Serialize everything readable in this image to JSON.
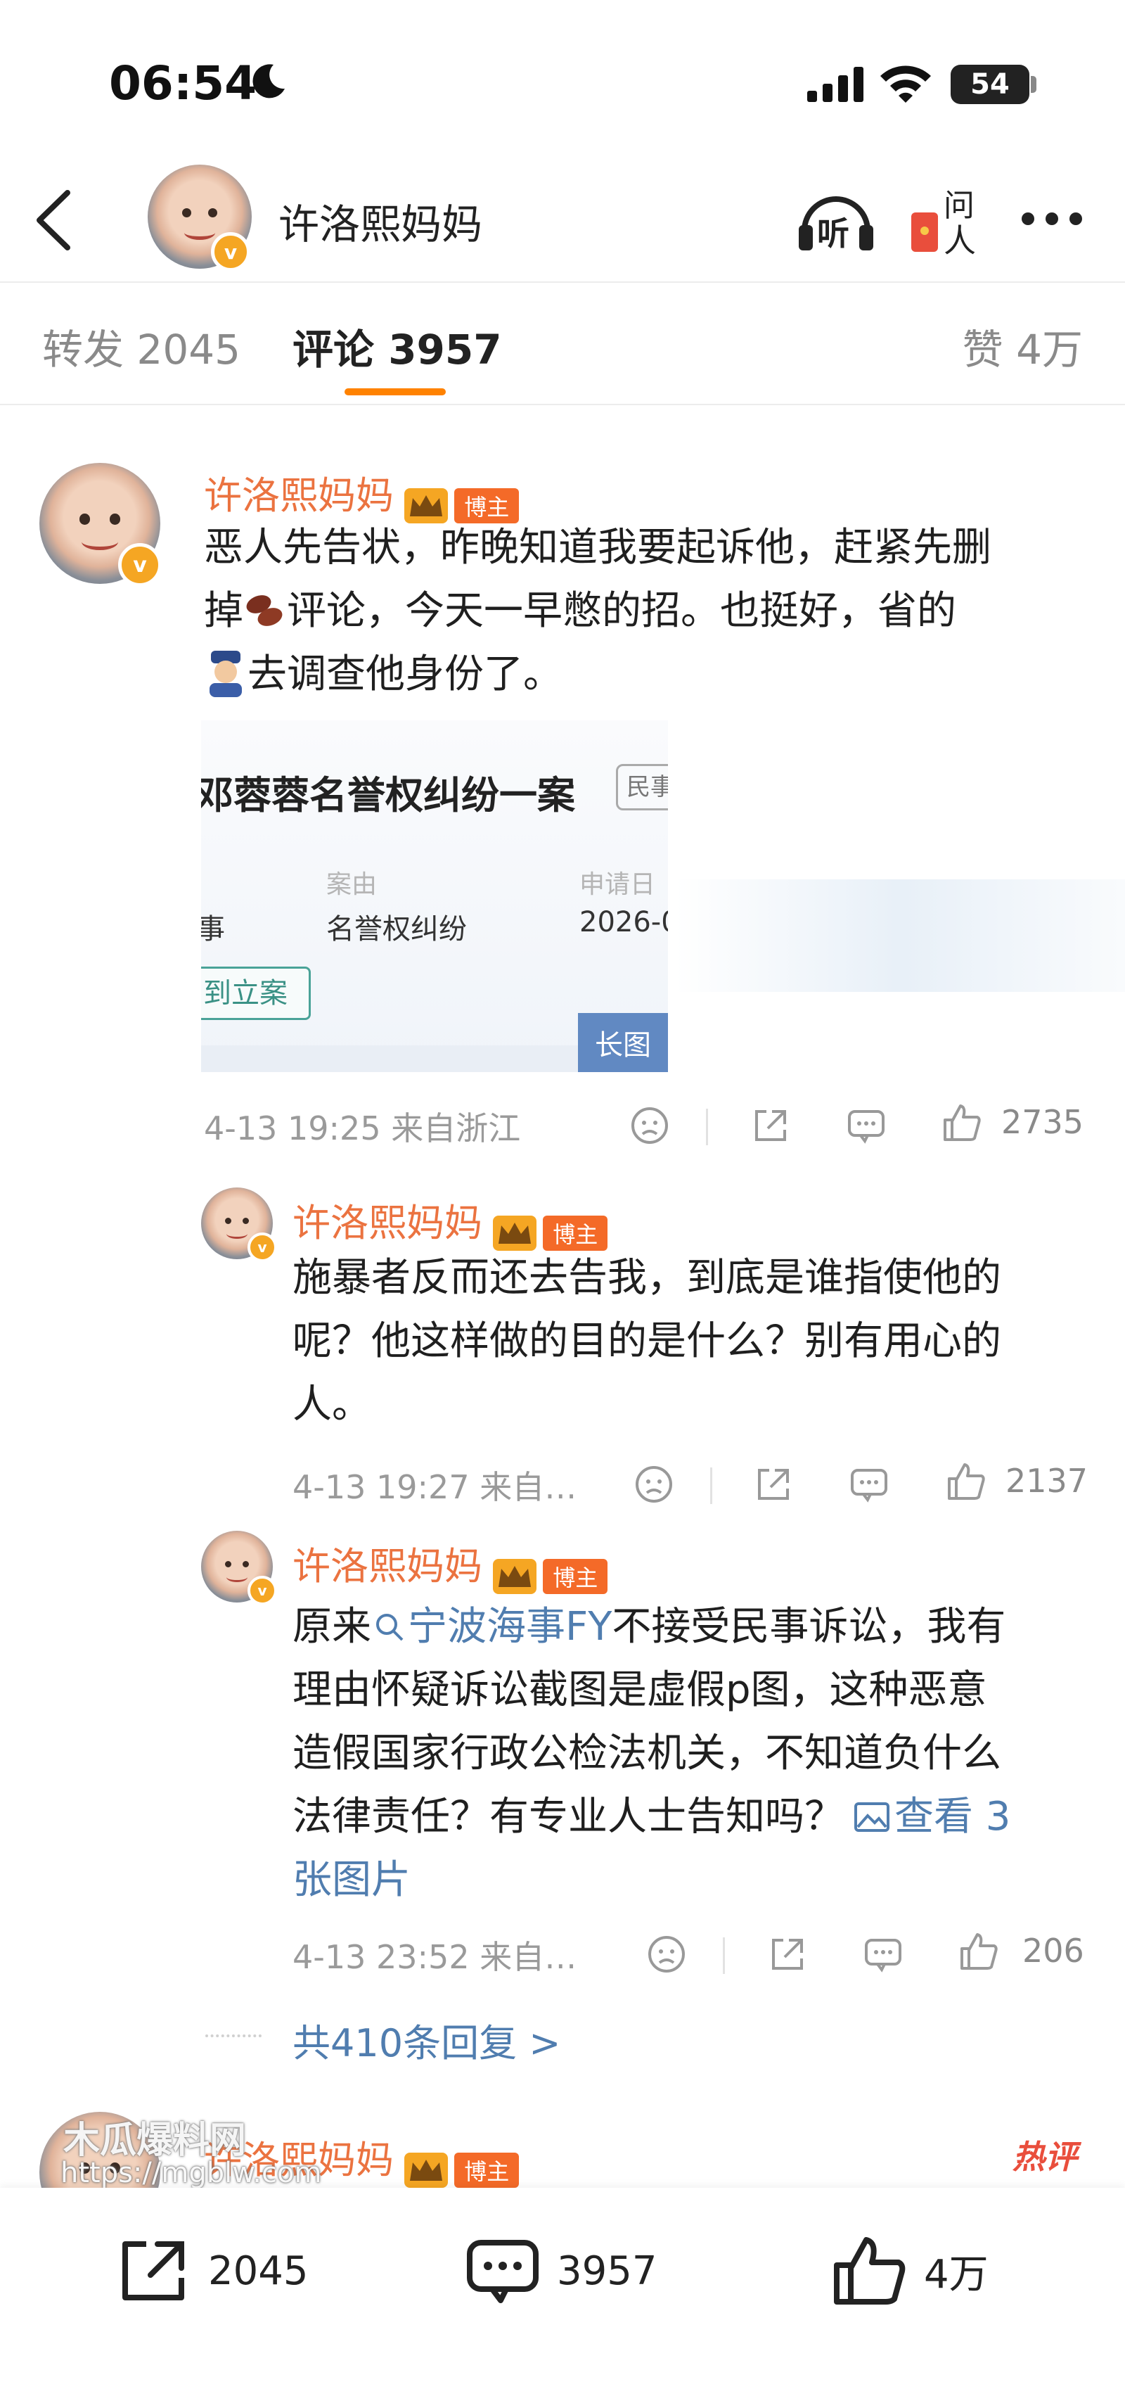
{
  "status_bar": {
    "time": "06:54",
    "battery": "54"
  },
  "header": {
    "name": "许洛熙妈妈",
    "listen_label": "听",
    "ask_label_1": "问",
    "ask_label_2": "人"
  },
  "tabs": {
    "repost": "转发 2045",
    "comment": "评论 3957",
    "like": "赞 4万"
  },
  "badge_label": "博主",
  "verified_mark": "v",
  "comments": [
    {
      "name": "许洛熙妈妈",
      "text_1": "恶人先告状，昨晚知道我要起诉他，赶紧先删",
      "text_2a": "掉",
      "text_2b": "评论，今天一早憋的招。也挺好，省的",
      "text_3": "去调查他身份了。",
      "image": {
        "title": "邓蓉蓉名誉权纠纷一案",
        "tag": "民事",
        "label_1": "案由",
        "value_1": "名誉权纠纷",
        "label_2": "申请日",
        "value_2": "2026-0",
        "prefix_value": "事",
        "button": "到立案",
        "long_image": "长图"
      },
      "meta": "4-13 19:25 来自浙江",
      "likes": "2735"
    },
    {
      "name": "许洛熙妈妈",
      "line_1": "施暴者反而还去告我，到底是谁指使他的",
      "line_2": "呢？他这样做的目的是什么？别有用心的",
      "line_3": "人。",
      "meta": "4-13 19:27 来自…",
      "likes": "2137"
    },
    {
      "name": "许洛熙妈妈",
      "line_1a": "原来",
      "topic": "宁波海事FY",
      "line_1b": "不接受民事诉讼，我有",
      "line_2": "理由怀疑诉讼截图是虚假p图，这种恶意",
      "line_3": "造假国家行政公检法机关，不知道负什么",
      "line_4a": "法律责任？有专业人士告知吗？",
      "view_images": "查看 3",
      "line_5": "张图片",
      "meta": "4-13 23:52 来自…",
      "likes": "206"
    }
  ],
  "more_replies": "共410条回复 >",
  "teaser": {
    "name": "许洛熙妈妈",
    "hot": "热评"
  },
  "watermark": {
    "line_1": "木瓜爆料网",
    "line_2": "https://mgblw.com"
  },
  "bottom_bar": {
    "repost": "2045",
    "comment": "3957",
    "like": "4万"
  }
}
